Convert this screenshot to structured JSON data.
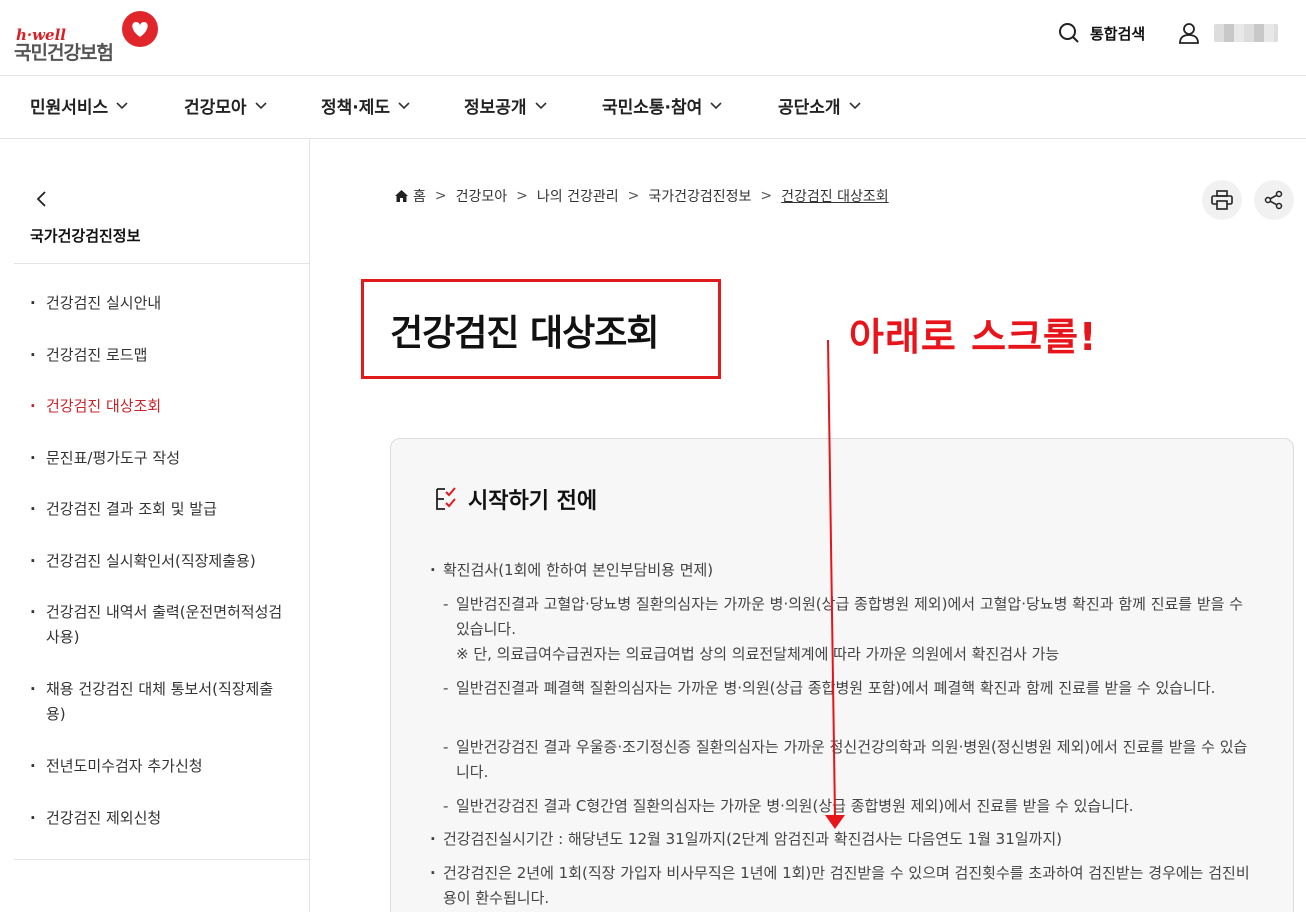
{
  "header": {
    "logo_small": "h·well",
    "logo_name": "국민건강보험",
    "search_label": "통합검색"
  },
  "gnb": [
    {
      "label": "민원서비스"
    },
    {
      "label": "건강모아"
    },
    {
      "label": "정책·제도"
    },
    {
      "label": "정보공개"
    },
    {
      "label": "국민소통·참여"
    },
    {
      "label": "공단소개"
    }
  ],
  "sidebar": {
    "title": "국가건강검진정보",
    "items": [
      {
        "label": "건강검진 실시안내"
      },
      {
        "label": "건강검진 로드맵"
      },
      {
        "label": "건강검진 대상조회"
      },
      {
        "label": "문진표/평가도구 작성"
      },
      {
        "label": "건강검진 결과 조회 및 발급"
      },
      {
        "label": "건강검진 실시확인서(직장제출용)"
      },
      {
        "label": "건강검진 내역서 출력(운전면허적성검사용)"
      },
      {
        "label": "채용 건강검진 대체 통보서(직장제출용)"
      },
      {
        "label": "전년도미수검자 추가신청"
      },
      {
        "label": "건강검진 제외신청"
      }
    ]
  },
  "breadcrumb": {
    "home": "홈",
    "items": [
      "건강모아",
      "나의 건강관리",
      "국가건강검진정보"
    ],
    "current": "건강검진 대상조회"
  },
  "main": {
    "page_title": "건강검진 대상조회",
    "annotation": "아래로 스크롤!",
    "card_title": "시작하기 전에",
    "bullet1": "확진검사(1회에 한하여 본인부담비용 면제)",
    "sub1": "일반검진결과 고혈압·당뇨병 질환의심자는 가까운 병·의원(상급 종합병원 제외)에서 고혈압·당뇨병 확진과 함께 진료를 받을 수 있습니다.",
    "sub1_note": "※ 단, 의료급여수급권자는 의료급여법 상의 의료전달체계에 따라 가까운 의원에서 확진검사 가능",
    "sub2": "일반검진결과 폐결핵 질환의심자는 가까운 병·의원(상급 종합병원 포함)에서 폐결핵 확진과 함께 진료를 받을 수 있습니다.",
    "sub3": "일반건강검진 결과 우울증·조기정신증 질환의심자는 가까운 정신건강의학과 의원·병원(정신병원 제외)에서 진료를 받을 수 있습니다.",
    "sub4": "일반건강검진 결과 C형간염 질환의심자는 가까운 병·의원(상급 종합병원 제외)에서 진료를 받을 수 있습니다.",
    "bullet2": "건강검진실시기간 : 해당년도 12월 31일까지(2단계 암검진과 확진검사는 다음연도 1월 31일까지)",
    "bullet3": "건강검진은 2년에 1회(직장 가입자 비사무직은 1년에 1회)만 검진받을 수 있으며 검진횟수를 초과하여 검진받는 경우에는 검진비용이 환수됩니다."
  }
}
